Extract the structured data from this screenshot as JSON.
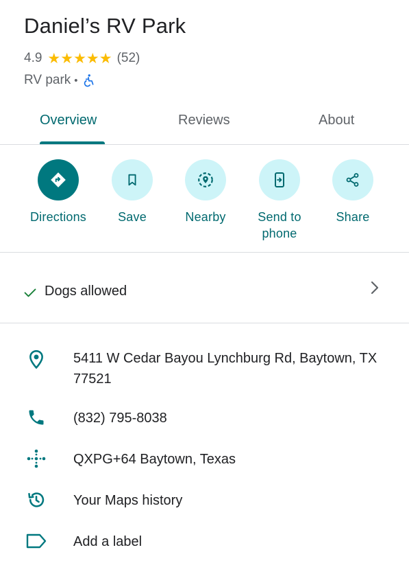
{
  "place": {
    "name": "Daniel’s RV Park",
    "rating": "4.9",
    "stars": "★★★★★",
    "review_count": "(52)",
    "category": "RV park",
    "separator": "•",
    "accessibility_icon": "wheelchair-icon"
  },
  "tabs": [
    {
      "label": "Overview",
      "active": true
    },
    {
      "label": "Reviews",
      "active": false
    },
    {
      "label": "About",
      "active": false
    }
  ],
  "actions": [
    {
      "label": "Directions",
      "icon": "directions-icon"
    },
    {
      "label": "Save",
      "icon": "bookmark-icon"
    },
    {
      "label": "Nearby",
      "icon": "nearby-icon"
    },
    {
      "label": "Send to phone",
      "icon": "send-to-phone-icon"
    },
    {
      "label": "Share",
      "icon": "share-icon"
    }
  ],
  "attribute": {
    "label": "Dogs allowed",
    "icon": "check-icon"
  },
  "info": [
    {
      "text": "5411 W Cedar Bayou Lynchburg Rd, Baytown, TX 77521",
      "icon": "location-pin-icon"
    },
    {
      "text": "(832) 795-8038",
      "icon": "phone-icon"
    },
    {
      "text": "QXPG+64 Baytown, Texas",
      "icon": "plus-code-icon"
    },
    {
      "text": "Your Maps history",
      "icon": "history-icon"
    },
    {
      "text": "Add a label",
      "icon": "label-icon"
    }
  ],
  "colors": {
    "accent": "#00787f",
    "accent_light": "#cdf4f8",
    "star": "#fbbc04",
    "check": "#188038"
  }
}
